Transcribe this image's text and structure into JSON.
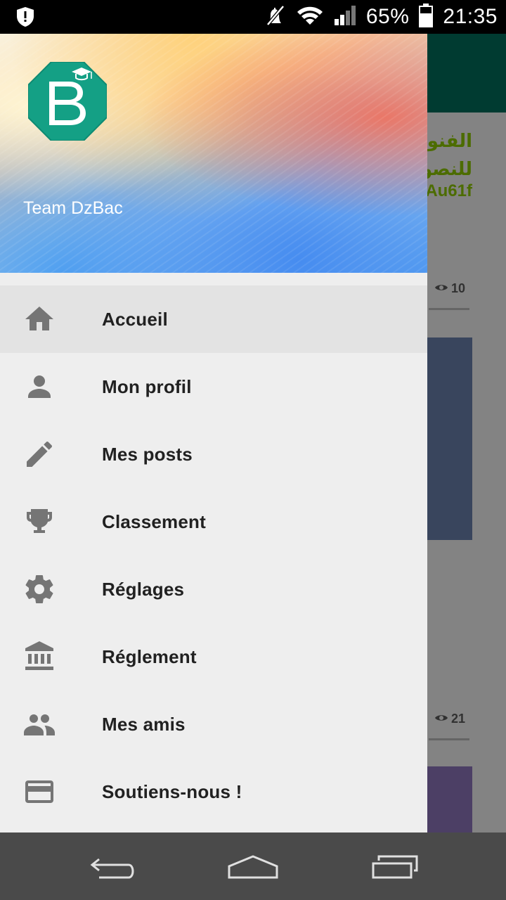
{
  "status_bar": {
    "battery": "65%",
    "time": "21:35",
    "icons": [
      "shield-alert-icon",
      "mute-icon",
      "wifi-icon",
      "signal-icon",
      "battery-icon"
    ]
  },
  "background_app": {
    "card_title_line1": "الفنون",
    "card_title_line2": "للنصو",
    "card_code": "Au61f",
    "views_1": "10",
    "views_2": "21",
    "toolbar_color": "#00463a"
  },
  "drawer": {
    "header_name": "Team DzBac",
    "logo_letter": "B",
    "logo_color": "#14a085",
    "items": [
      {
        "label": "Accueil",
        "icon": "home-icon",
        "active": true
      },
      {
        "label": "Mon profil",
        "icon": "person-icon",
        "active": false
      },
      {
        "label": "Mes posts",
        "icon": "pencil-icon",
        "active": false
      },
      {
        "label": "Classement",
        "icon": "trophy-icon",
        "active": false
      },
      {
        "label": "Réglages",
        "icon": "gear-icon",
        "active": false
      },
      {
        "label": "Réglement",
        "icon": "bank-icon",
        "active": false
      },
      {
        "label": "Mes amis",
        "icon": "people-icon",
        "active": false
      },
      {
        "label": "Soutiens-nous !",
        "icon": "credit-card-icon",
        "active": false
      }
    ]
  },
  "navbar": {
    "buttons": [
      "back-icon",
      "home-nav-icon",
      "recents-icon"
    ]
  }
}
